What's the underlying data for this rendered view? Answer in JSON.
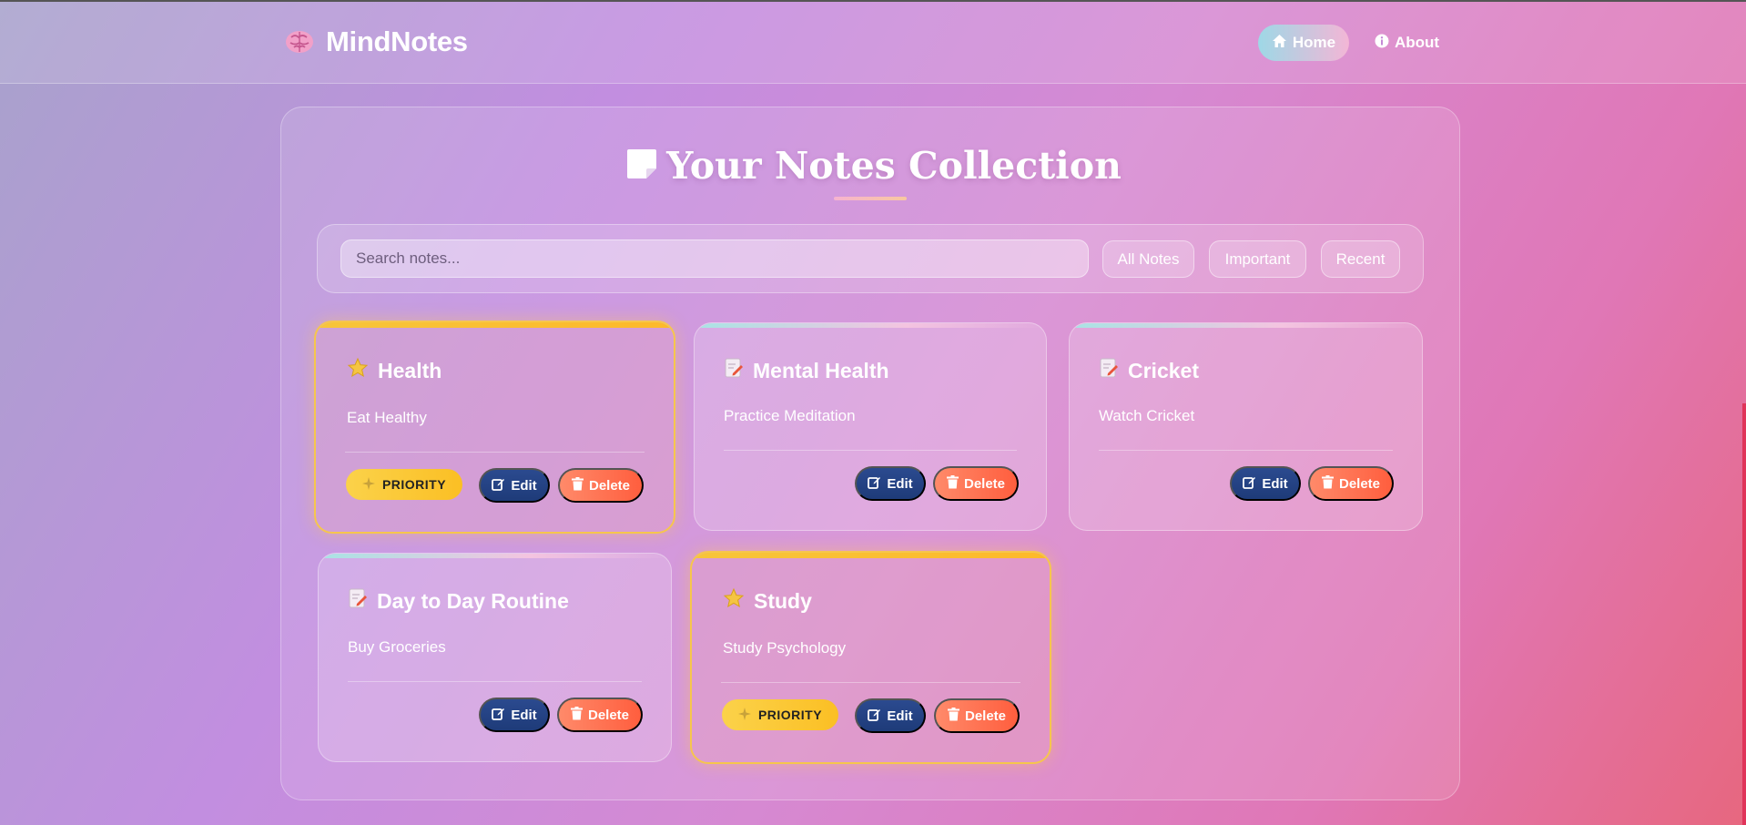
{
  "brand": {
    "name": "MindNotes",
    "icon": "brain-icon"
  },
  "nav": {
    "home_label": "Home",
    "about_label": "About"
  },
  "page": {
    "title": "Your Notes Collection"
  },
  "search": {
    "placeholder": "Search notes..."
  },
  "filters": {
    "all": "All Notes",
    "important": "Important",
    "recent": "Recent"
  },
  "labels": {
    "edit": "Edit",
    "delete": "Delete",
    "priority": "PRIORITY"
  },
  "notes": [
    {
      "title": "Health",
      "body": "Eat Healthy",
      "important": true,
      "icon": "star-icon"
    },
    {
      "title": "Mental Health",
      "body": "Practice Meditation",
      "important": false,
      "icon": "memo-icon"
    },
    {
      "title": "Cricket",
      "body": "Watch Cricket",
      "important": false,
      "icon": "memo-icon"
    },
    {
      "title": "Day to Day Routine",
      "body": "Buy Groceries",
      "important": false,
      "icon": "memo-icon"
    },
    {
      "title": "Study",
      "body": "Study Psychology",
      "important": true,
      "icon": "star-icon"
    }
  ],
  "colors": {
    "accent_gold": "#fbbf24",
    "edit_blue": "#1e3b79",
    "delete_orange": "#ff5e3e"
  }
}
